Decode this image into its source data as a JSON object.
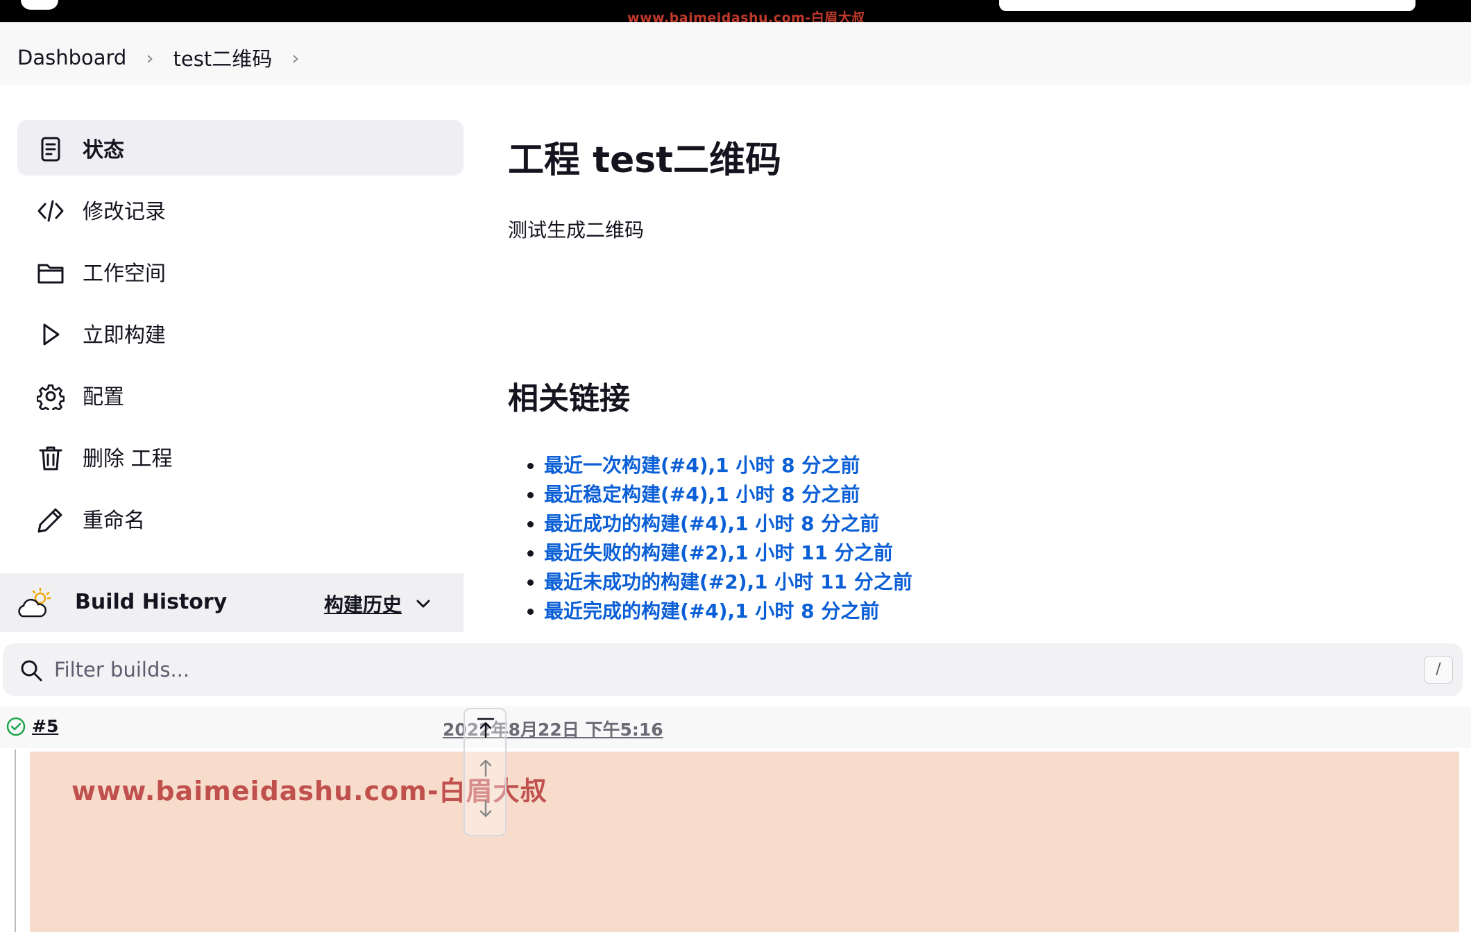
{
  "header": {
    "watermark": "www.baimeidashu.com-白眉大叔"
  },
  "breadcrumb": {
    "items": [
      "Dashboard",
      "test二维码"
    ]
  },
  "sidebar": {
    "items": [
      {
        "label": "状态",
        "icon": "document-icon",
        "active": true
      },
      {
        "label": "修改记录",
        "icon": "code-icon",
        "active": false
      },
      {
        "label": "工作空间",
        "icon": "folder-icon",
        "active": false
      },
      {
        "label": "立即构建",
        "icon": "play-icon",
        "active": false
      },
      {
        "label": "配置",
        "icon": "gear-icon",
        "active": false
      },
      {
        "label": "删除 工程",
        "icon": "trash-icon",
        "active": false
      },
      {
        "label": "重命名",
        "icon": "pencil-icon",
        "active": false
      }
    ]
  },
  "build_history": {
    "title": "Build History",
    "link_label": "构建历史",
    "filter_placeholder": "Filter builds...",
    "shortcut": "/",
    "builds": [
      {
        "number": "#5",
        "date": "2022年8月22日 下午5:16",
        "status": "success"
      }
    ],
    "body_watermark": "www.baimeidashu.com-白眉大叔"
  },
  "main": {
    "title": "工程 test二维码",
    "description": "测试生成二维码",
    "related_title": "相关链接",
    "links": [
      "最近一次构建(#4),1 小时 8 分之前",
      "最近稳定构建(#4),1 小时 8 分之前",
      "最近成功的构建(#4),1 小时 8 分之前",
      "最近失败的构建(#2),1 小时 11 分之前",
      "最近未成功的构建(#2),1 小时 11 分之前",
      "最近完成的构建(#4),1 小时 8 分之前"
    ]
  },
  "colors": {
    "link": "#0b5fd6",
    "success": "#1ea64b",
    "build_bg": "#f8dccb"
  }
}
